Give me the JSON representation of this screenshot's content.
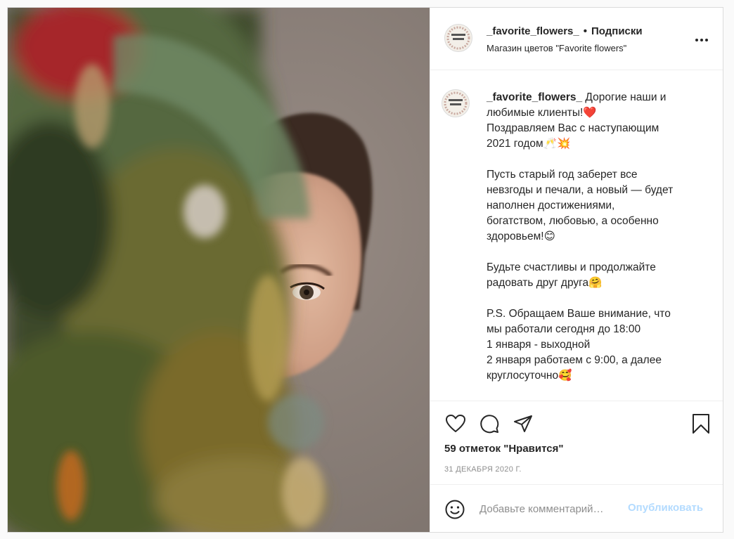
{
  "post": {
    "username": "_favorite_flowers_",
    "follow_separator": "•",
    "follow_label": "Подписки",
    "location": "Магазин цветов \"Favorite flowers\"",
    "avatar_text": "FAVORITE FLOWERS",
    "caption_username": "_favorite_flowers_",
    "caption_text": " Дорогие наши и\nлюбимые клиенты!❤️\nПоздравляем Вас с наступающим\n2021 годом🥂💥\n\nПусть старый год заберет все\nневзгоды и печали, а новый — будет\nнаполнен достижениями,\nбогатством, любовью, а особенно\nздоровьем!😊\n\nБудьте счастливы и продолжайте\nрадовать друг друга🤗\n\nP.S. Обращаем Ваше внимание, что\nмы работали сегодня до 18:00\n1 января - выходной\n2 января работаем с 9:00, а далее\nкруглосуточно🥰",
    "likes": "59 отметок \"Нравится\"",
    "date": "31 ДЕКАБРЯ 2020 Г.",
    "comment_placeholder": "Добавьте комментарий…",
    "publish_label": "Опубликовать"
  },
  "icons": {
    "more": "more-options-icon",
    "like": "heart-icon",
    "comment": "comment-icon",
    "share": "paper-plane-icon",
    "save": "bookmark-icon",
    "emoji": "smiley-icon"
  },
  "colors": {
    "border": "#dbdbdb",
    "text": "#262626",
    "muted": "#8e8e8e",
    "publish_disabled": "#b3dbff"
  }
}
